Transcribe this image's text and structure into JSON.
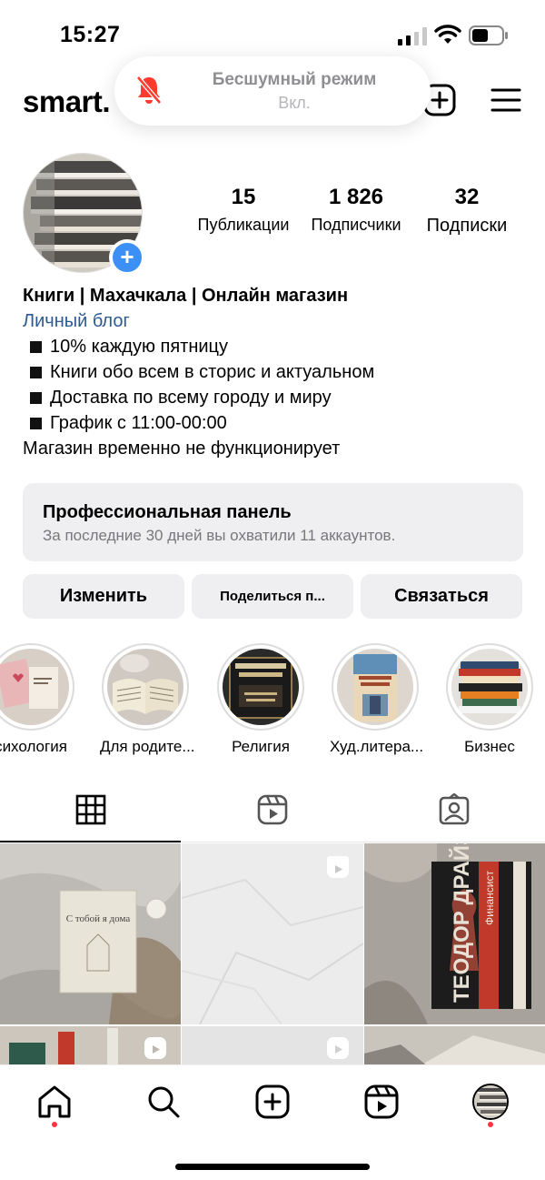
{
  "status_bar": {
    "time": "15:27"
  },
  "silent_toast": {
    "title": "Бесшумный режим",
    "subtitle": "Вкл."
  },
  "header": {
    "username": "smart."
  },
  "profile": {
    "stats": [
      {
        "value": "15",
        "label": "Публикации"
      },
      {
        "value": "1 826",
        "label": "Подписчики"
      },
      {
        "value": "32",
        "label": "Подписки"
      }
    ],
    "bio": {
      "name": "Книги | Махачкала | Онлайн магазин",
      "category": "Личный блог",
      "lines": [
        "10% каждую пятницу",
        "Книги обо всем в сторис и актуальном",
        "Доставка по всему городу и миру",
        "График с 11:00-00:00"
      ],
      "note": "Магазин временно не функционирует"
    }
  },
  "pro_panel": {
    "title": "Профессиональная панель",
    "subtitle": "За последние 30 дней вы охватили 11 аккаунтов."
  },
  "buttons": {
    "edit": "Изменить",
    "share": "Поделиться п...",
    "contact": "Связаться"
  },
  "highlights": [
    {
      "label": "сихология"
    },
    {
      "label": "Для родите..."
    },
    {
      "label": "Религия"
    },
    {
      "label": "Худ.литера..."
    },
    {
      "label": "Бизнес"
    }
  ],
  "posts": [
    {
      "book_title": "С тобой я дома"
    },
    {
      "book_title": ""
    },
    {
      "book_title": "ТЕОДОР ДРАЙЗЕР",
      "book_subtitle": "Финансист"
    }
  ],
  "colors": {
    "accent": "#3b8ff5",
    "link": "#2c5a91",
    "notification_dot": "#ff3040",
    "panel_bg": "#efeff1"
  }
}
